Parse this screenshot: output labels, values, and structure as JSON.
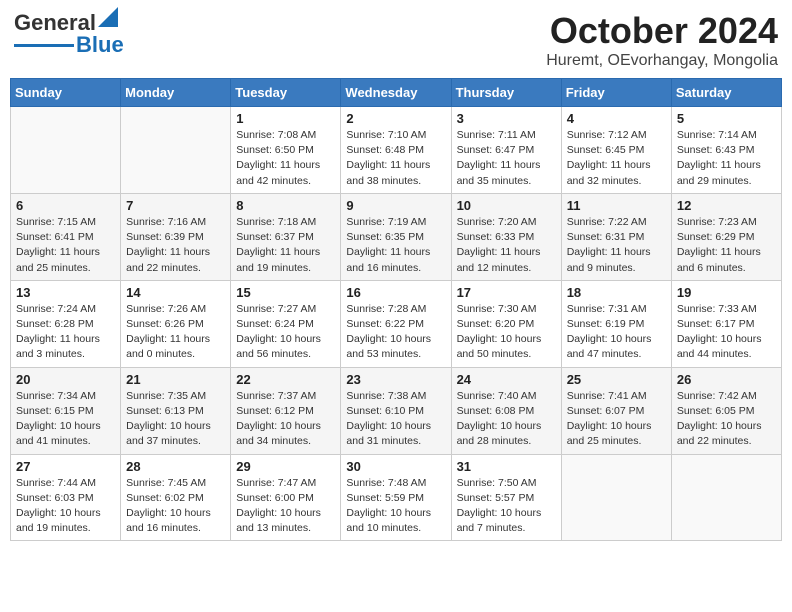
{
  "header": {
    "logo": {
      "general": "General",
      "blue": "Blue"
    },
    "month": "October 2024",
    "location": "Huremt, OEvorhangay, Mongolia"
  },
  "days_of_week": [
    "Sunday",
    "Monday",
    "Tuesday",
    "Wednesday",
    "Thursday",
    "Friday",
    "Saturday"
  ],
  "weeks": [
    [
      {
        "day": "",
        "info": ""
      },
      {
        "day": "",
        "info": ""
      },
      {
        "day": "1",
        "sunrise": "Sunrise: 7:08 AM",
        "sunset": "Sunset: 6:50 PM",
        "daylight": "Daylight: 11 hours and 42 minutes."
      },
      {
        "day": "2",
        "sunrise": "Sunrise: 7:10 AM",
        "sunset": "Sunset: 6:48 PM",
        "daylight": "Daylight: 11 hours and 38 minutes."
      },
      {
        "day": "3",
        "sunrise": "Sunrise: 7:11 AM",
        "sunset": "Sunset: 6:47 PM",
        "daylight": "Daylight: 11 hours and 35 minutes."
      },
      {
        "day": "4",
        "sunrise": "Sunrise: 7:12 AM",
        "sunset": "Sunset: 6:45 PM",
        "daylight": "Daylight: 11 hours and 32 minutes."
      },
      {
        "day": "5",
        "sunrise": "Sunrise: 7:14 AM",
        "sunset": "Sunset: 6:43 PM",
        "daylight": "Daylight: 11 hours and 29 minutes."
      }
    ],
    [
      {
        "day": "6",
        "sunrise": "Sunrise: 7:15 AM",
        "sunset": "Sunset: 6:41 PM",
        "daylight": "Daylight: 11 hours and 25 minutes."
      },
      {
        "day": "7",
        "sunrise": "Sunrise: 7:16 AM",
        "sunset": "Sunset: 6:39 PM",
        "daylight": "Daylight: 11 hours and 22 minutes."
      },
      {
        "day": "8",
        "sunrise": "Sunrise: 7:18 AM",
        "sunset": "Sunset: 6:37 PM",
        "daylight": "Daylight: 11 hours and 19 minutes."
      },
      {
        "day": "9",
        "sunrise": "Sunrise: 7:19 AM",
        "sunset": "Sunset: 6:35 PM",
        "daylight": "Daylight: 11 hours and 16 minutes."
      },
      {
        "day": "10",
        "sunrise": "Sunrise: 7:20 AM",
        "sunset": "Sunset: 6:33 PM",
        "daylight": "Daylight: 11 hours and 12 minutes."
      },
      {
        "day": "11",
        "sunrise": "Sunrise: 7:22 AM",
        "sunset": "Sunset: 6:31 PM",
        "daylight": "Daylight: 11 hours and 9 minutes."
      },
      {
        "day": "12",
        "sunrise": "Sunrise: 7:23 AM",
        "sunset": "Sunset: 6:29 PM",
        "daylight": "Daylight: 11 hours and 6 minutes."
      }
    ],
    [
      {
        "day": "13",
        "sunrise": "Sunrise: 7:24 AM",
        "sunset": "Sunset: 6:28 PM",
        "daylight": "Daylight: 11 hours and 3 minutes."
      },
      {
        "day": "14",
        "sunrise": "Sunrise: 7:26 AM",
        "sunset": "Sunset: 6:26 PM",
        "daylight": "Daylight: 11 hours and 0 minutes."
      },
      {
        "day": "15",
        "sunrise": "Sunrise: 7:27 AM",
        "sunset": "Sunset: 6:24 PM",
        "daylight": "Daylight: 10 hours and 56 minutes."
      },
      {
        "day": "16",
        "sunrise": "Sunrise: 7:28 AM",
        "sunset": "Sunset: 6:22 PM",
        "daylight": "Daylight: 10 hours and 53 minutes."
      },
      {
        "day": "17",
        "sunrise": "Sunrise: 7:30 AM",
        "sunset": "Sunset: 6:20 PM",
        "daylight": "Daylight: 10 hours and 50 minutes."
      },
      {
        "day": "18",
        "sunrise": "Sunrise: 7:31 AM",
        "sunset": "Sunset: 6:19 PM",
        "daylight": "Daylight: 10 hours and 47 minutes."
      },
      {
        "day": "19",
        "sunrise": "Sunrise: 7:33 AM",
        "sunset": "Sunset: 6:17 PM",
        "daylight": "Daylight: 10 hours and 44 minutes."
      }
    ],
    [
      {
        "day": "20",
        "sunrise": "Sunrise: 7:34 AM",
        "sunset": "Sunset: 6:15 PM",
        "daylight": "Daylight: 10 hours and 41 minutes."
      },
      {
        "day": "21",
        "sunrise": "Sunrise: 7:35 AM",
        "sunset": "Sunset: 6:13 PM",
        "daylight": "Daylight: 10 hours and 37 minutes."
      },
      {
        "day": "22",
        "sunrise": "Sunrise: 7:37 AM",
        "sunset": "Sunset: 6:12 PM",
        "daylight": "Daylight: 10 hours and 34 minutes."
      },
      {
        "day": "23",
        "sunrise": "Sunrise: 7:38 AM",
        "sunset": "Sunset: 6:10 PM",
        "daylight": "Daylight: 10 hours and 31 minutes."
      },
      {
        "day": "24",
        "sunrise": "Sunrise: 7:40 AM",
        "sunset": "Sunset: 6:08 PM",
        "daylight": "Daylight: 10 hours and 28 minutes."
      },
      {
        "day": "25",
        "sunrise": "Sunrise: 7:41 AM",
        "sunset": "Sunset: 6:07 PM",
        "daylight": "Daylight: 10 hours and 25 minutes."
      },
      {
        "day": "26",
        "sunrise": "Sunrise: 7:42 AM",
        "sunset": "Sunset: 6:05 PM",
        "daylight": "Daylight: 10 hours and 22 minutes."
      }
    ],
    [
      {
        "day": "27",
        "sunrise": "Sunrise: 7:44 AM",
        "sunset": "Sunset: 6:03 PM",
        "daylight": "Daylight: 10 hours and 19 minutes."
      },
      {
        "day": "28",
        "sunrise": "Sunrise: 7:45 AM",
        "sunset": "Sunset: 6:02 PM",
        "daylight": "Daylight: 10 hours and 16 minutes."
      },
      {
        "day": "29",
        "sunrise": "Sunrise: 7:47 AM",
        "sunset": "Sunset: 6:00 PM",
        "daylight": "Daylight: 10 hours and 13 minutes."
      },
      {
        "day": "30",
        "sunrise": "Sunrise: 7:48 AM",
        "sunset": "Sunset: 5:59 PM",
        "daylight": "Daylight: 10 hours and 10 minutes."
      },
      {
        "day": "31",
        "sunrise": "Sunrise: 7:50 AM",
        "sunset": "Sunset: 5:57 PM",
        "daylight": "Daylight: 10 hours and 7 minutes."
      },
      {
        "day": "",
        "info": ""
      },
      {
        "day": "",
        "info": ""
      }
    ]
  ]
}
